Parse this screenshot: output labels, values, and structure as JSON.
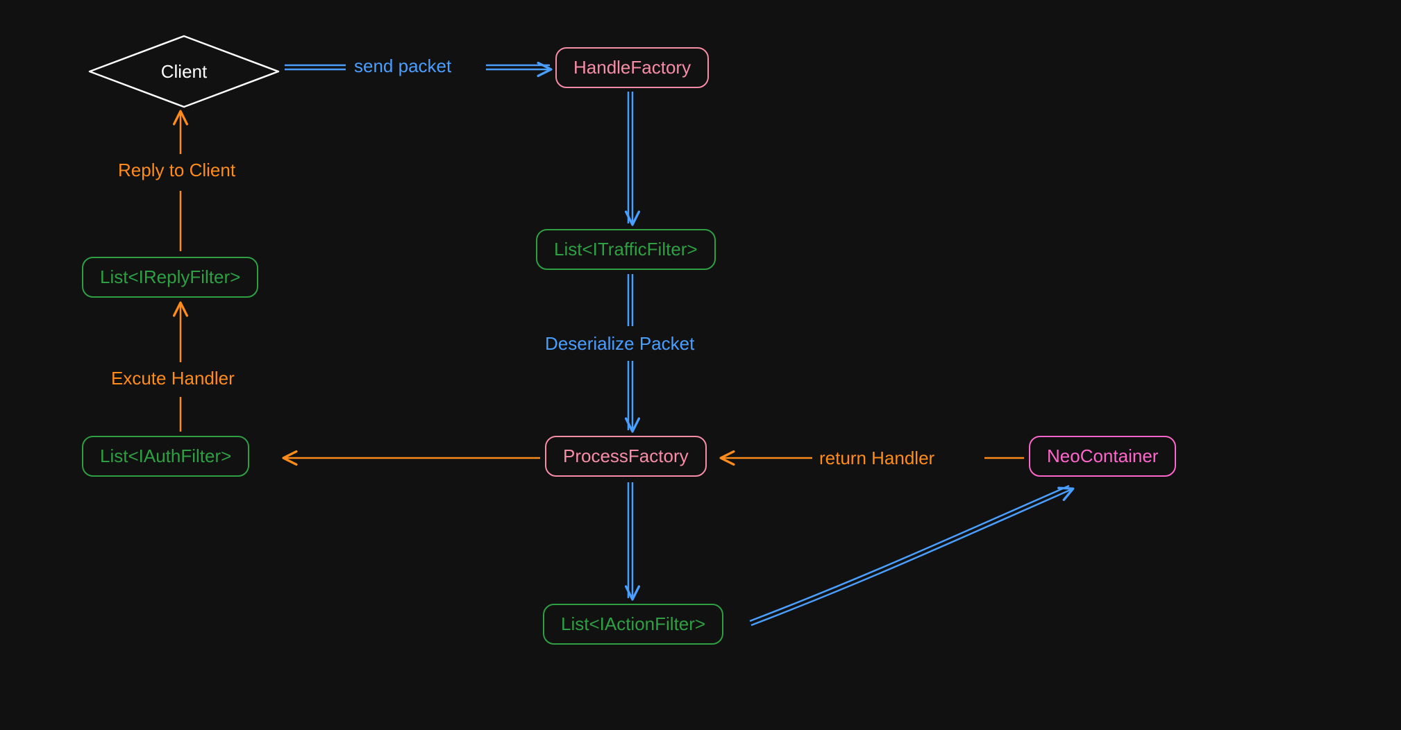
{
  "nodes": {
    "client": "Client",
    "handleFactory": "HandleFactory",
    "trafficFilter": "List<ITrafficFilter>",
    "processFactory": "ProcessFactory",
    "actionFilter": "List<IActionFilter>",
    "neoContainer": "NeoContainer",
    "authFilter": "List<IAuthFilter>",
    "replyFilter": "List<IReplyFilter>"
  },
  "edges": {
    "sendPacket": "send packet",
    "deserialize": "Deserialize Packet",
    "returnHandler": "return Handler",
    "executeHandler": "Excute Handler",
    "replyClient": "Reply to Client"
  },
  "colors": {
    "white": "#ffffff",
    "pink": "#f78da7",
    "green": "#2ea043",
    "blue": "#4a9eff",
    "orange": "#ff8c1a",
    "magenta": "#ff66cc"
  }
}
